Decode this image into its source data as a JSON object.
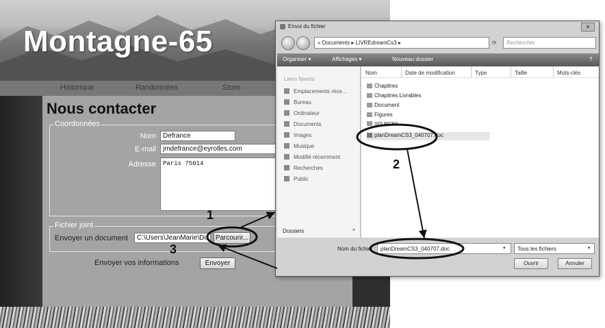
{
  "site": {
    "title": "Montagne-65",
    "nav": [
      "Historique",
      "Randonnées",
      "Store"
    ],
    "heading": "Nous contacter",
    "coordonnees": {
      "legend": "Coordonnées",
      "nom_label": "Nom",
      "nom_value": "Defrance",
      "email_label": "E-mail",
      "email_value": "jmdefrance@eyrolles.com",
      "adresse_label": "Adresse",
      "adresse_value": "Paris 75014"
    },
    "fichier": {
      "legend": "Fichier joint",
      "label": "Envoyer un document",
      "path_value": "C:\\Users\\JeanMarie\\Do",
      "browse_label": "Parcourir..."
    },
    "submit": {
      "label": "Envoyer vos informations",
      "button": "Envoyer"
    }
  },
  "dialog": {
    "title": "Envoi du fichier",
    "close": "✕",
    "address": "« Documents ▸ LIVREdreamCs3 ▸",
    "search_placeholder": "Rechercher",
    "toolbar": {
      "organize": "Organiser ▾",
      "views": "Affichages ▾",
      "new_folder": "Nouveau dossier"
    },
    "favorites_header": "Liens favoris",
    "favorites": [
      "Emplacements réce...",
      "Bureau",
      "Ordinateur",
      "Documents",
      "Images",
      "Musique",
      "Modifié récemment",
      "Recherches",
      "Public"
    ],
    "folders_label": "Dossiers",
    "columns": [
      "Nom",
      "Date de modification",
      "Type",
      "Taille",
      "Mots-clés"
    ],
    "files": [
      "Chapitres",
      "Chapitres Livrables",
      "Document",
      "Figures",
      "SOURCES",
      "planDreamCS3_040707.doc"
    ],
    "filename_label": "Nom du fichier :",
    "filename_value": "planDreamCS3_040707.doc",
    "filter_value": "Tous les fichiers",
    "open_button": "Ouvrir",
    "cancel_button": "Annuler"
  },
  "annotations": {
    "step1": "1",
    "step2": "2",
    "step3": "3"
  }
}
